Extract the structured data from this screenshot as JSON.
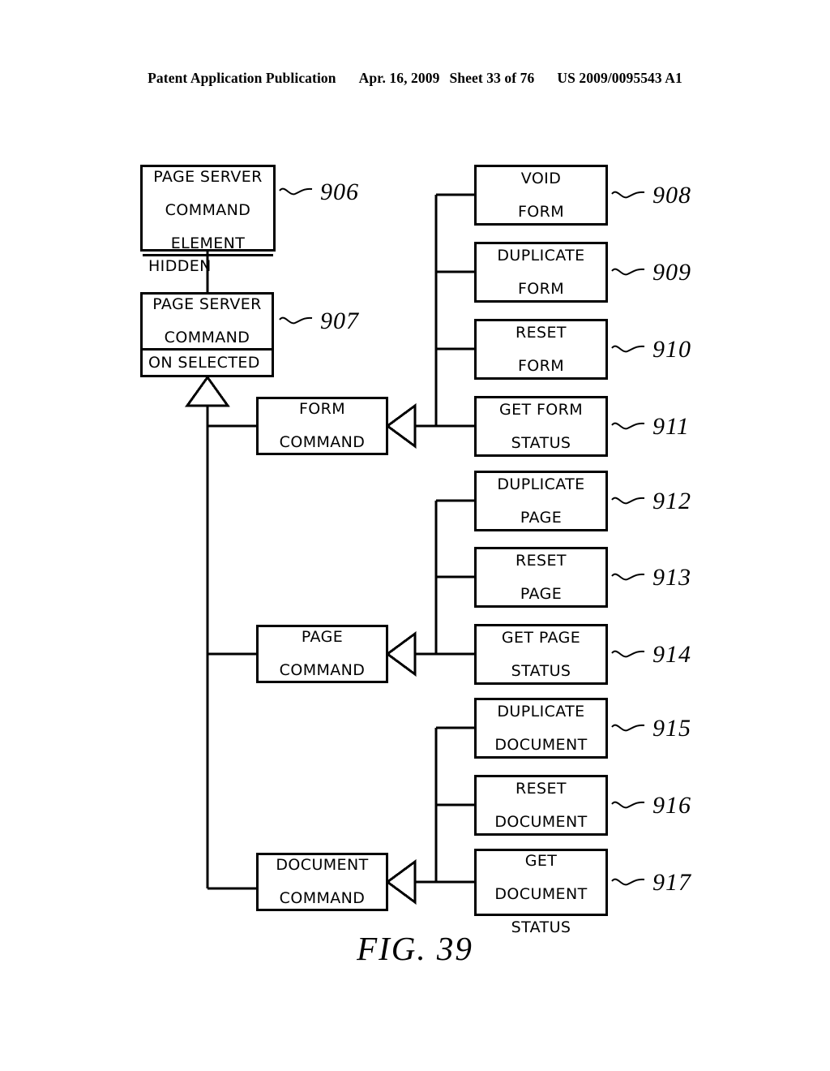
{
  "header": {
    "publication": "Patent Application Publication",
    "date": "Apr. 16, 2009",
    "sheet": "Sheet 33 of 76",
    "patent_number": "US 2009/0095543 A1"
  },
  "figure": {
    "caption": "FIG. 39",
    "line_color": "#000000",
    "background": "#ffffff"
  },
  "nodes": {
    "page_server_command_element": {
      "title": "PAGE SERVER\nCOMMAND\nELEMENT",
      "title_lines": [
        "PAGE SERVER",
        "COMMAND",
        "ELEMENT"
      ],
      "attribute": "HIDDEN",
      "ref": "906"
    },
    "page_server_command": {
      "title_lines": [
        "PAGE SERVER",
        "COMMAND"
      ],
      "attribute": "ON SELECTED",
      "ref": "907"
    },
    "form_command": {
      "title_lines": [
        "FORM",
        "COMMAND"
      ]
    },
    "page_command": {
      "title_lines": [
        "PAGE",
        "COMMAND"
      ]
    },
    "document_command": {
      "title_lines": [
        "DOCUMENT",
        "COMMAND"
      ]
    }
  },
  "form_group": [
    {
      "label_lines": [
        "VOID",
        "FORM"
      ],
      "ref": "908"
    },
    {
      "label_lines": [
        "DUPLICATE",
        "FORM"
      ],
      "ref": "909"
    },
    {
      "label_lines": [
        "RESET",
        "FORM"
      ],
      "ref": "910"
    },
    {
      "label_lines": [
        "GET FORM",
        "STATUS"
      ],
      "ref": "911"
    }
  ],
  "page_group": [
    {
      "label_lines": [
        "DUPLICATE",
        "PAGE"
      ],
      "ref": "912"
    },
    {
      "label_lines": [
        "RESET",
        "PAGE"
      ],
      "ref": "913"
    },
    {
      "label_lines": [
        "GET PAGE",
        "STATUS"
      ],
      "ref": "914"
    }
  ],
  "document_group": [
    {
      "label_lines": [
        "DUPLICATE",
        "DOCUMENT"
      ],
      "ref": "915"
    },
    {
      "label_lines": [
        "RESET",
        "DOCUMENT"
      ],
      "ref": "916"
    },
    {
      "label_lines": [
        "GET",
        "DOCUMENT",
        "STATUS"
      ],
      "ref": "917"
    }
  ]
}
